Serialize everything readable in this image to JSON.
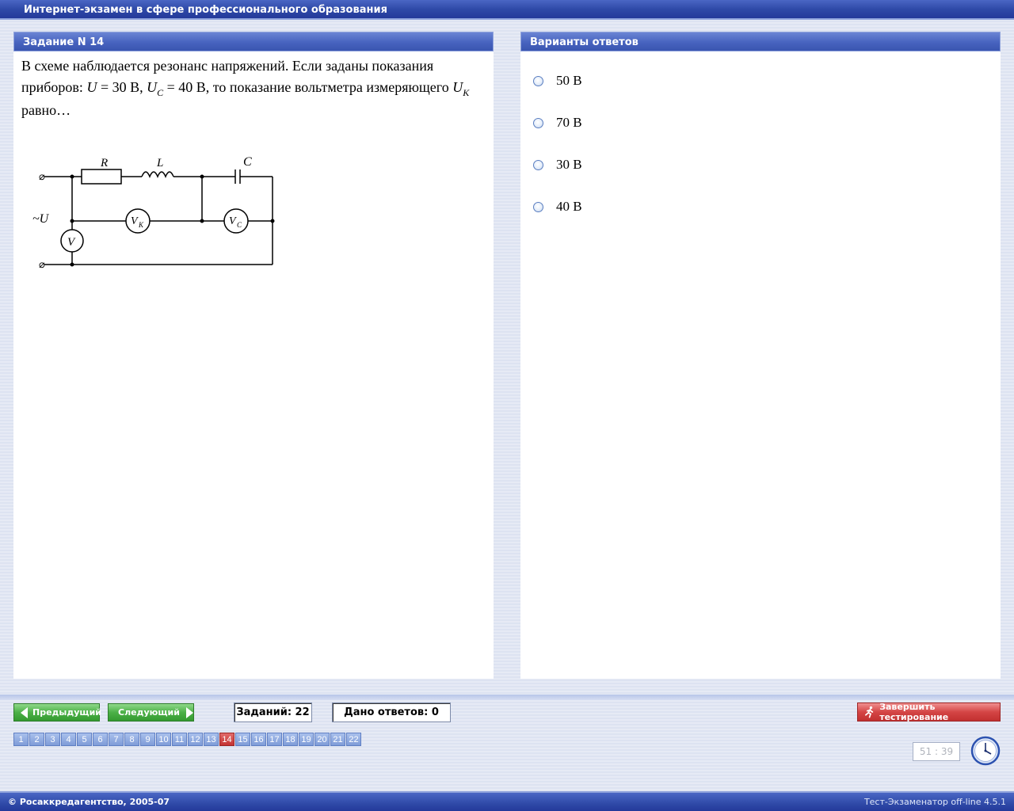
{
  "window": {
    "title": "Интернет-экзамен в сфере профессионального образования"
  },
  "question_panel": {
    "header": "Задание N 14",
    "text_part1": "В схеме наблюдается резонанс напряжений. Если заданы показания приборов: ",
    "text_U": "U",
    "text_eq1": " = 30",
    "text_part2": " В, ",
    "text_Uc": "U",
    "text_Uc_sub": "C",
    "text_eq2": " = 40",
    "text_part3": " В, то показание вольтметра измеряющего ",
    "text_Uk": "U",
    "text_Uk_sub": "K",
    "text_part4": " равно…",
    "circuit": {
      "label_R": "R",
      "label_L": "L",
      "label_C": "C",
      "label_source": "~U",
      "label_V": "V",
      "label_VK": "V",
      "label_VK_sub": "K",
      "label_VC": "V",
      "label_VC_sub": "C"
    }
  },
  "answers_panel": {
    "header": "Варианты ответов",
    "options": [
      {
        "label": "50 В"
      },
      {
        "label": "70 В"
      },
      {
        "label": "30 В"
      },
      {
        "label": "40 В"
      }
    ]
  },
  "navigation": {
    "prev_label": "Предыдущий",
    "next_label": "Следующий",
    "tasks_count": "Заданий: 22",
    "answers_given": "Дано ответов: 0",
    "finish_label": "Завершить тестирование",
    "pages": [
      "1",
      "2",
      "3",
      "4",
      "5",
      "6",
      "7",
      "8",
      "9",
      "10",
      "11",
      "12",
      "13",
      "14",
      "15",
      "16",
      "17",
      "18",
      "19",
      "20",
      "21",
      "22"
    ],
    "current_page": "14",
    "timer": "51 : 39"
  },
  "footer": {
    "copyright": "© Росаккредагентство, 2005-07",
    "version": "Тест-Экзаменатор off-line 4.5.1"
  },
  "colors": {
    "title_bar": "#2f4aa8",
    "panel_header": "#4763bf",
    "nav_button": "#4cb047",
    "finish_button": "#d44545",
    "active_page": "#c43232",
    "page_button": "#7f9cd8"
  },
  "icons": [
    "arrow-left-icon",
    "arrow-right-icon",
    "running-man-icon",
    "clock-icon",
    "radio-icon"
  ]
}
